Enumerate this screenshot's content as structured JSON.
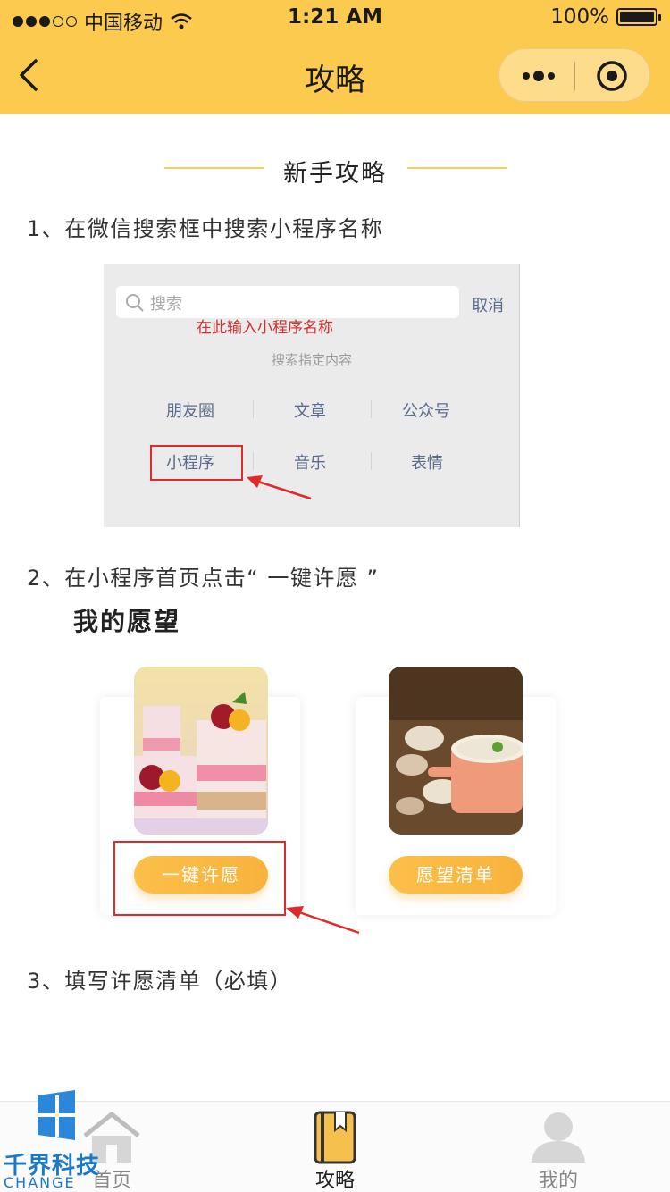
{
  "status_bar": {
    "carrier": "中国移动",
    "time": "1:21 AM",
    "battery": "100%",
    "battery_level": 1.0
  },
  "nav": {
    "title": "攻略"
  },
  "guide": {
    "section_title": "新手攻略",
    "step1": "1、在微信搜索框中搜索小程序名称",
    "step2": "2、在小程序首页点击“ 一键许愿 ”",
    "step3": "3、填写许愿清单（必填）"
  },
  "search_mock": {
    "placeholder": "搜索",
    "cancel": "取消",
    "hint": "在此输入小程序名称",
    "sub": "搜索指定内容",
    "categories": [
      "朋友圈",
      "文章",
      "公众号",
      "小程序",
      "音乐",
      "表情"
    ]
  },
  "wish_mock": {
    "title": "我的愿望",
    "button_wish": "一键许愿",
    "button_list": "愿望清单"
  },
  "tabbar": {
    "items": [
      {
        "label": "首页"
      },
      {
        "label": "攻略"
      },
      {
        "label": "我的"
      }
    ]
  },
  "watermark": {
    "brand": "千界科技",
    "sub": "CHANGE"
  },
  "colors": {
    "accent": "#fcca4f",
    "annotation_red": "#e02a2a",
    "pill": "#f8b23c"
  }
}
